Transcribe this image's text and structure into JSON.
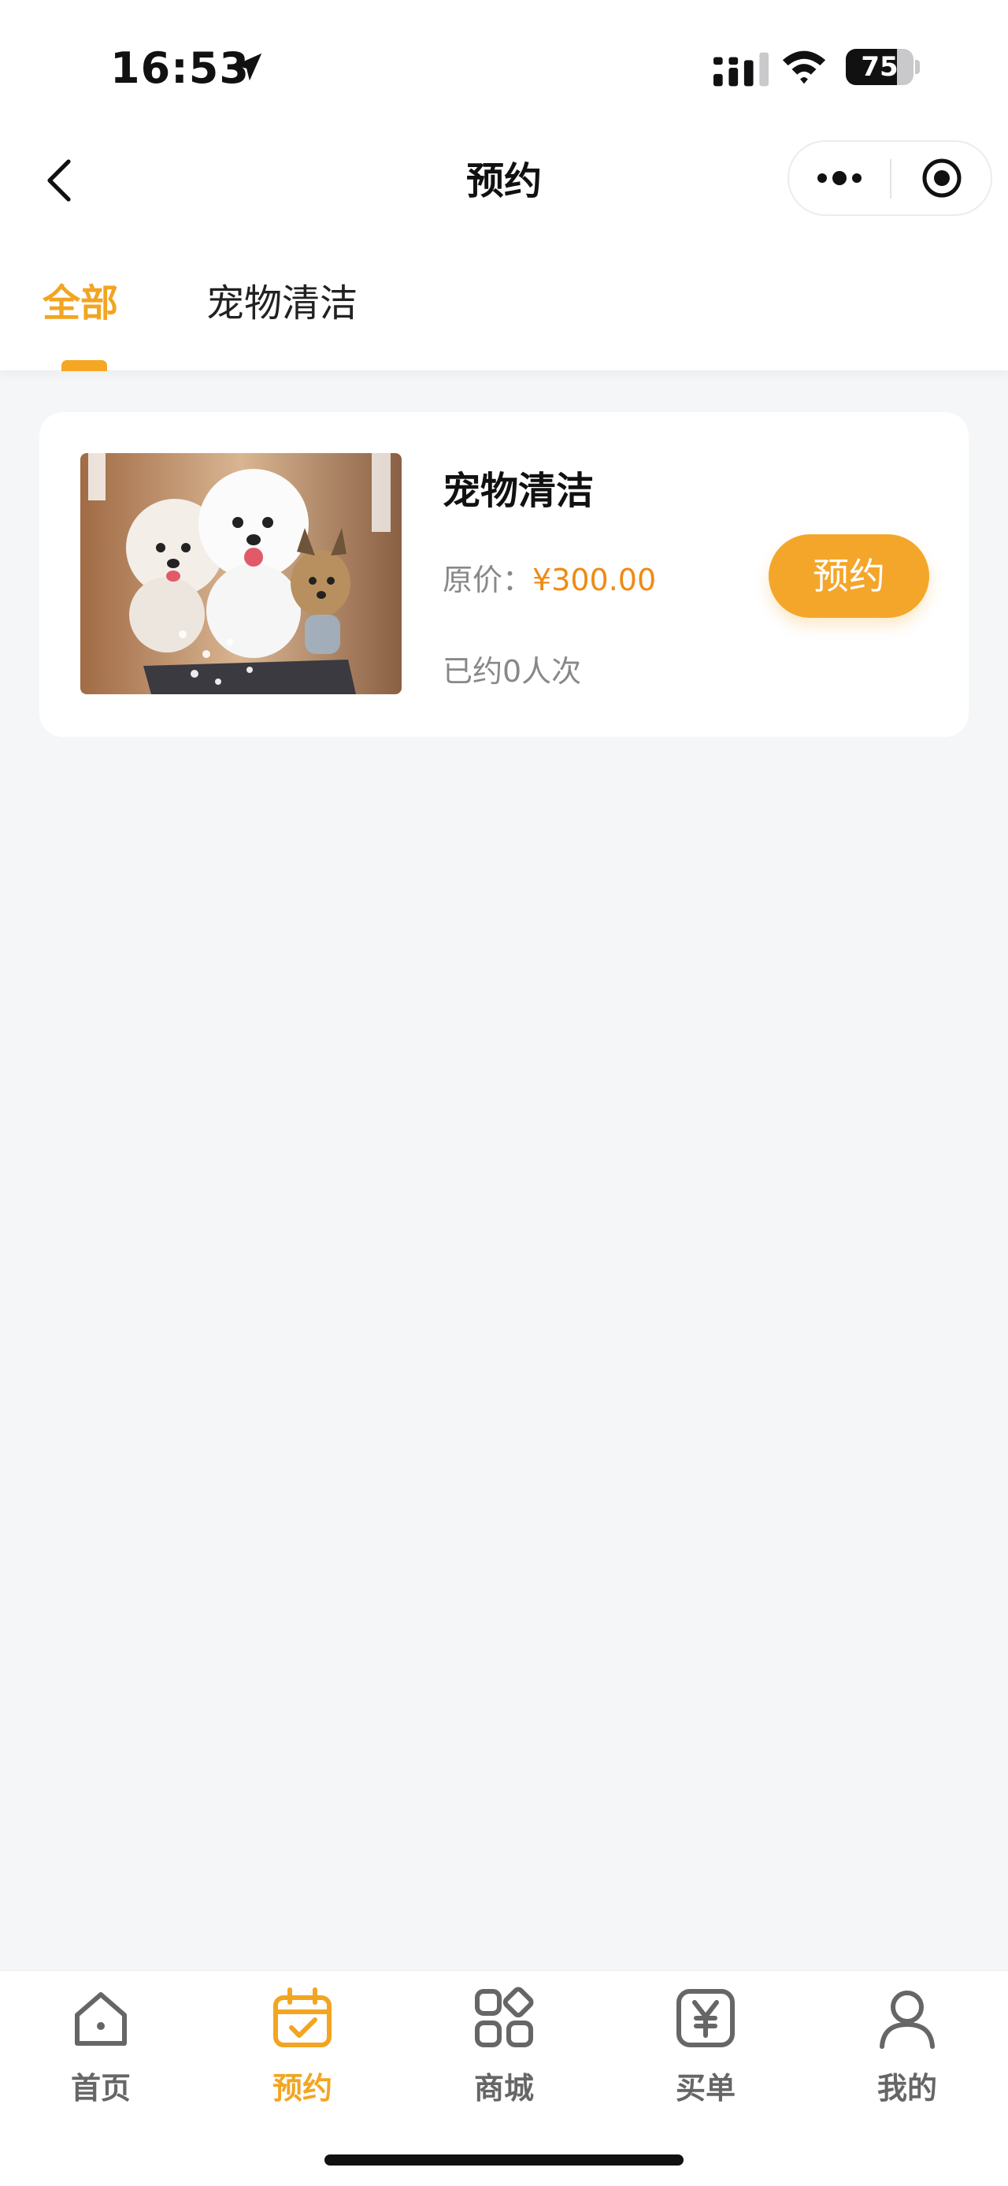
{
  "status_bar": {
    "time": "16:53",
    "battery": "75",
    "battery_level": 0.75,
    "icons": [
      "location-arrow-icon",
      "cellular-signal-icon",
      "wifi-icon",
      "battery-icon"
    ]
  },
  "nav": {
    "title": "预约",
    "icons": [
      "back-chevron-icon",
      "more-dots-icon",
      "close-target-icon"
    ]
  },
  "tabs": [
    {
      "label": "全部",
      "active": true
    },
    {
      "label": "宠物清洁",
      "active": false
    }
  ],
  "services": [
    {
      "name": "宠物清洁",
      "price_label": "原价：",
      "price": "¥300.00",
      "booked": "已约0人次",
      "button": "预约"
    }
  ],
  "tabbar": [
    {
      "label": "首页",
      "icon": "home-icon",
      "active": false
    },
    {
      "label": "预约",
      "icon": "calendar-check-icon",
      "active": true
    },
    {
      "label": "商城",
      "icon": "grid-shop-icon",
      "active": false
    },
    {
      "label": "买单",
      "icon": "yen-bill-icon",
      "active": false
    },
    {
      "label": "我的",
      "icon": "user-icon",
      "active": false
    }
  ],
  "colors": {
    "accent": "#f4a62a",
    "price": "#f08a14",
    "background": "#f5f6f8",
    "inactive": "#666666"
  }
}
